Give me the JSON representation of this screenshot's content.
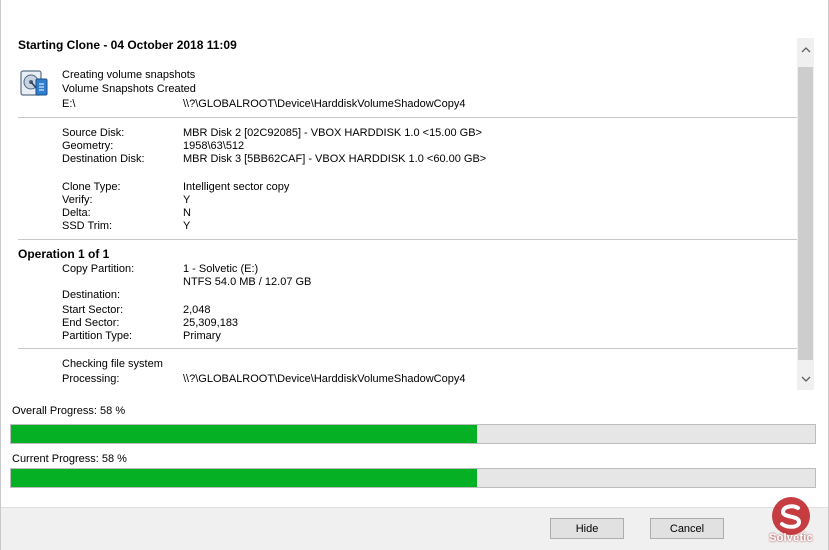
{
  "log": {
    "title": "Starting Clone - 04 October 2018  11:09",
    "snapshot": {
      "line1": "Creating volume snapshots",
      "line2": "Volume Snapshots Created",
      "drive": "E:\\",
      "path": "\\\\?\\GLOBALROOT\\Device\\HarddiskVolumeShadowCopy4"
    },
    "disk_info": [
      {
        "label": "Source Disk:",
        "value": "MBR Disk 2 [02C92085] - VBOX HARDDISK 1.0  <15.00 GB>"
      },
      {
        "label": "Geometry:",
        "value": "1958\\63\\512"
      },
      {
        "label": "Destination Disk:",
        "value": "MBR Disk 3 [5BB62CAF] - VBOX HARDDISK 1.0  <60.00 GB>"
      }
    ],
    "clone_info": [
      {
        "label": "Clone Type:",
        "value": "Intelligent sector copy"
      },
      {
        "label": "Verify:",
        "value": "Y"
      },
      {
        "label": "Delta:",
        "value": "N"
      },
      {
        "label": "SSD Trim:",
        "value": "Y"
      }
    ],
    "operation": {
      "title": "Operation 1 of 1",
      "copy_partition_label": "Copy Partition:",
      "copy_partition_value1": "1 - Solvetic (E:)",
      "copy_partition_value2": "NTFS 54.0 MB / 12.07 GB",
      "destination_label": "Destination:",
      "details": [
        {
          "label": "Start Sector:",
          "value": "2,048"
        },
        {
          "label": "End Sector:",
          "value": "25,309,183"
        },
        {
          "label": "Partition Type:",
          "value": "Primary"
        }
      ]
    },
    "checking": {
      "line1": "Checking file system",
      "processing_label": "Processing:",
      "processing_value": "\\\\?\\GLOBALROOT\\Device\\HarddiskVolumeShadowCopy4"
    }
  },
  "progress": {
    "overall_label": "Overall Progress:  58 %",
    "overall_value": 58,
    "current_label": "Current Progress:  58 %",
    "current_value": 58
  },
  "buttons": {
    "hide": "Hide",
    "cancel": "Cancel"
  },
  "watermark": {
    "text": "Solvetic"
  },
  "colors": {
    "progress_fill": "#06b025",
    "watermark_red": "#c0282d"
  },
  "icons": {
    "disk": "hard-disk-icon",
    "scroll_up": "chevron-up-icon",
    "scroll_down": "chevron-down-icon",
    "watermark": "solvetic-logo-icon"
  }
}
